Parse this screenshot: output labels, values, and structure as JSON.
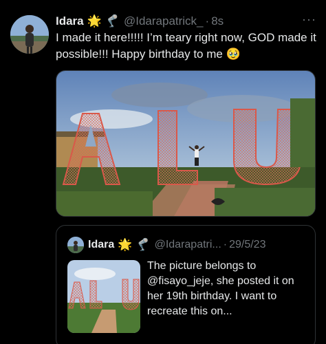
{
  "tweet": {
    "author_name": "Idara",
    "emoji_star": "🌟",
    "emoji_leg": "🦿",
    "handle": "@Idarapatrick_",
    "separator": "·",
    "time": "8s",
    "more_icon": "···",
    "text": "I made it here!!!!! I’m teary right now, GOD made it possible!!! Happy birthday to me 🥹",
    "media": {
      "letters": "ALU",
      "description_icon": "photo-sculpture-letters"
    }
  },
  "quoted_tweet": {
    "author_name": "Idara",
    "emoji_star": "🌟",
    "emoji_leg": "🦿",
    "handle": "@Idarapatri...",
    "separator": "·",
    "date": "29/5/23",
    "text": "The picture belongs to @fisayo_jeje, she posted it on her 19th birthday. I want to recreate this on..."
  },
  "colors": {
    "background": "#000000",
    "text_primary": "#e7e9ea",
    "text_secondary": "#71767b",
    "border": "#2f3336",
    "sculpture": "#d9584a"
  }
}
